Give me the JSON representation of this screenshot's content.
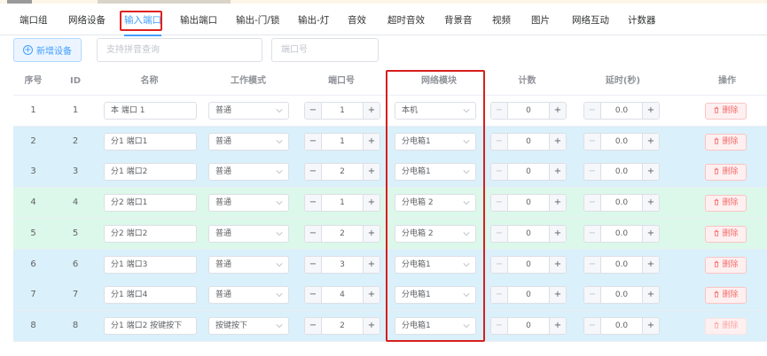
{
  "tabs": [
    "端口组",
    "网络设备",
    "输入端口",
    "输出端口",
    "输出-门/锁",
    "输出-灯",
    "音效",
    "超时音效",
    "背景音",
    "视频",
    "图片",
    "网络互动",
    "计数器"
  ],
  "active_tab": 2,
  "toolbar": {
    "add_label": "新增设备",
    "search_placeholder": "支持拼音查询",
    "port_placeholder": "端口号"
  },
  "columns": [
    "序号",
    "ID",
    "名称",
    "工作模式",
    "端口号",
    "网络模块",
    "计数",
    "延时(秒)",
    "操作"
  ],
  "delete_label": "删除",
  "rows": [
    {
      "seq": "1",
      "id": "1",
      "name": "本 端口 1",
      "mode": "普通",
      "port": "1",
      "module": "本机",
      "count": "0",
      "delay": "0.0",
      "delete_disabled": false
    },
    {
      "seq": "2",
      "id": "2",
      "name": "分1 端口1",
      "mode": "普通",
      "port": "1",
      "module": "分电箱1",
      "count": "0",
      "delay": "0.0",
      "delete_disabled": false
    },
    {
      "seq": "3",
      "id": "3",
      "name": "分1 端口2",
      "mode": "普通",
      "port": "2",
      "module": "分电箱1",
      "count": "0",
      "delay": "0.0",
      "delete_disabled": false
    },
    {
      "seq": "4",
      "id": "4",
      "name": "分2 端口1",
      "mode": "普通",
      "port": "1",
      "module": "分电箱 2",
      "count": "0",
      "delay": "0.0",
      "delete_disabled": false
    },
    {
      "seq": "5",
      "id": "5",
      "name": "分2 端口2",
      "mode": "普通",
      "port": "2",
      "module": "分电箱 2",
      "count": "0",
      "delay": "0.0",
      "delete_disabled": false
    },
    {
      "seq": "6",
      "id": "6",
      "name": "分1 端口3",
      "mode": "普通",
      "port": "3",
      "module": "分电箱1",
      "count": "0",
      "delay": "0.0",
      "delete_disabled": false
    },
    {
      "seq": "7",
      "id": "7",
      "name": "分1 端口4",
      "mode": "普通",
      "port": "4",
      "module": "分电箱1",
      "count": "0",
      "delay": "0.0",
      "delete_disabled": false
    },
    {
      "seq": "8",
      "id": "8",
      "name": "分1 端口2 按键按下",
      "mode": "按键按下",
      "port": "2",
      "module": "分电箱1",
      "count": "0",
      "delay": "0.0",
      "delete_disabled": true
    }
  ],
  "row_colors": [
    "#ffffff",
    "#daf0fa",
    "#daf0fa",
    "#dcf8ea",
    "#dcf8ea",
    "#daf0fa",
    "#daf0fa",
    "#daf0fa"
  ],
  "colors": {
    "accent": "#409eff",
    "danger": "#f56c6c",
    "highlight_box": "#e02020"
  },
  "icons": {
    "add": "plus-circle-icon",
    "select": "chevron-down-icon",
    "delete": "trash-icon"
  }
}
